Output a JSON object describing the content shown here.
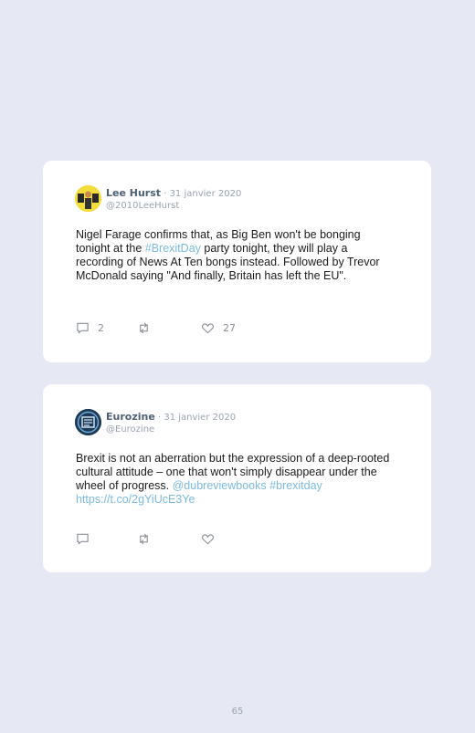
{
  "tweets": [
    {
      "author": "Lee Hurst",
      "date": " · 31 janvier 2020",
      "handle": "@2010LeeHurst",
      "text_1": "Nigel Farage confirms that, as Big Ben won't be bonging tonight at the ",
      "hashtag": "#BrexitDay",
      "text_2": " party tonight, they will play a recording of News At Ten bongs instead. Followed by Trevor McDonald saying \"And finally, Britain has left the EU\".",
      "replies": "2",
      "retweets": "",
      "likes": "27"
    },
    {
      "author": "Eurozine",
      "date": " · 31 janvier 2020",
      "handle": "@Eurozine",
      "text_1": "Brexit is not an aberration but the expression of a deep-rooted cultural attitude – one that won't simply disappear under the wheel of progress. ",
      "mention": "@dubreviewbooks",
      "hashtag_link": "#brexitday https://t.co/2gYiUcE3Ye",
      "replies": "",
      "retweets": "",
      "likes": ""
    }
  ],
  "icons": {
    "reply": "reply-icon",
    "retweet": "retweet-icon",
    "like": "heart-icon"
  },
  "colors": {
    "background": "#e6e8f4",
    "card": "#ffffff",
    "link": "#7bbbe0",
    "name": "#4e6076"
  },
  "page_number": "65"
}
